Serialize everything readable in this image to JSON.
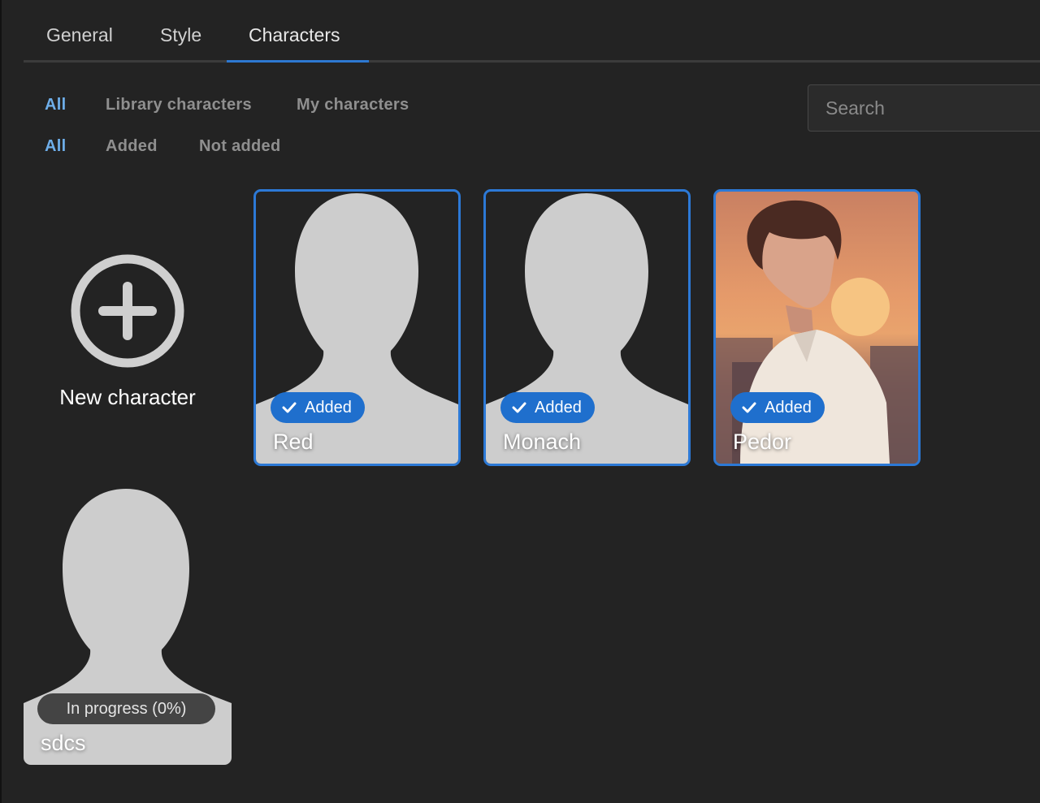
{
  "tabs": [
    {
      "label": "General",
      "active": false
    },
    {
      "label": "Style",
      "active": false
    },
    {
      "label": "Characters",
      "active": true
    }
  ],
  "filters": {
    "source": [
      {
        "label": "All",
        "active": true
      },
      {
        "label": "Library characters",
        "active": false
      },
      {
        "label": "My characters",
        "active": false
      }
    ],
    "status": [
      {
        "label": "All",
        "active": true
      },
      {
        "label": "Added",
        "active": false
      },
      {
        "label": "Not added",
        "active": false
      }
    ]
  },
  "search": {
    "placeholder": "Search",
    "value": ""
  },
  "new_character": {
    "label": "New character",
    "icon": "plus-circle-icon"
  },
  "characters": [
    {
      "name": "Red",
      "badge": "Added",
      "image": "silhouette"
    },
    {
      "name": "Monach",
      "badge": "Added",
      "image": "silhouette"
    },
    {
      "name": "Pedor",
      "badge": "Added",
      "image": "portrait"
    },
    {
      "name": "sdcs",
      "status": "In progress (0%)",
      "progress": 0,
      "image": "silhouette"
    }
  ],
  "colors": {
    "accent": "#2c79d6",
    "active_filter": "#6eaee9",
    "background": "#232323",
    "silhouette": "#cdcdcd",
    "badge": "#1f6fcd"
  }
}
